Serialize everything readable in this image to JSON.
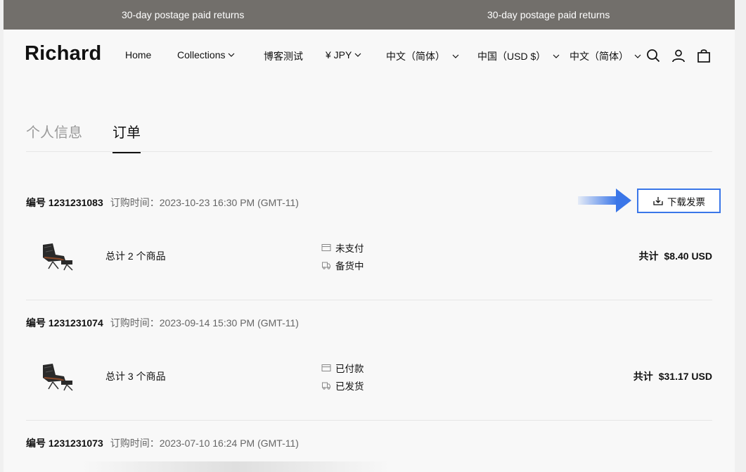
{
  "announcement": {
    "left": "30-day postage paid returns",
    "right": "30-day postage paid returns"
  },
  "header": {
    "logo": "Richard",
    "nav": {
      "home": "Home",
      "collections": "Collections",
      "blog": "博客测试",
      "currency": "¥ JPY",
      "language": "中文（简体）",
      "region": "中国（USD $）",
      "language2": "中文（简体）"
    },
    "icons": [
      "search-icon",
      "account-icon",
      "cart-icon"
    ]
  },
  "tabs": {
    "profile": "个人信息",
    "orders": "订单"
  },
  "invoice_button": "下载发票",
  "orders": [
    {
      "number": "编号 1231231083",
      "time": "订购时间：2023-10-23 16:30 PM (GMT-11)",
      "count": "总计 2 个商品",
      "payment": "未支付",
      "shipping": "备货中",
      "total_label": "共计",
      "total_value": "$8.40 USD"
    },
    {
      "number": "编号 1231231074",
      "time": "订购时间：2023-09-14 15:30 PM (GMT-11)",
      "count": "总计 3 个商品",
      "payment": "已付款",
      "shipping": "已发货",
      "total_label": "共计",
      "total_value": "$31.17 USD"
    },
    {
      "number": "编号 1231231073",
      "time": "订购时间：2023-07-10 16:24 PM (GMT-11)"
    }
  ],
  "colors": {
    "announcement_bg": "#726f6b",
    "highlight_border": "#3a76e8"
  }
}
